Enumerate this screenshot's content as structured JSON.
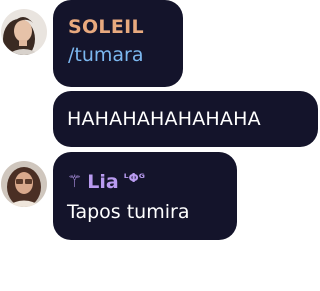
{
  "messages": [
    {
      "sender": "SOLEIL",
      "text": "/tumara",
      "name_color": "#e8a97e",
      "text_color": "#7cb8f0",
      "avatar": "profile-photo"
    },
    {
      "sender": "",
      "text": "HAHAHAHAHAHAHA"
    },
    {
      "sender": "Lia",
      "sender_icon": "⚚",
      "sender_badge": "ᴸΦᴳ",
      "text": "Tapos tumira",
      "name_color": "#b99bf0",
      "avatar": "profile-photo"
    }
  ],
  "colors": {
    "bubble": "#14142b",
    "background": "#ffffff"
  }
}
